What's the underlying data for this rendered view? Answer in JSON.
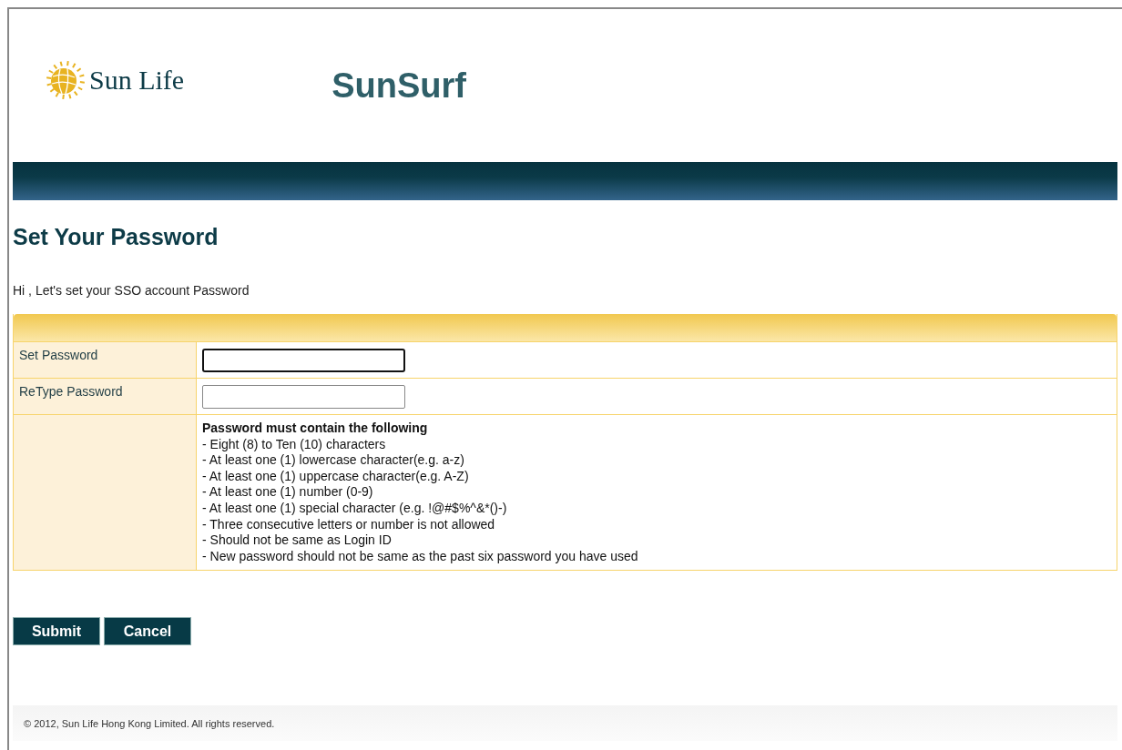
{
  "header": {
    "logo_text": "Sun Life",
    "app_title": "SunSurf"
  },
  "page_title": "Set Your Password",
  "greeting": "Hi  , Let's set your SSO account Password",
  "form": {
    "fields": [
      {
        "label": "Set Password",
        "focused": true
      },
      {
        "label": "ReType Password",
        "focused": false
      }
    ],
    "rules_title": "Password must contain the following",
    "rules": [
      "- Eight (8) to Ten (10) characters",
      "- At least one (1) lowercase character(e.g. a-z)",
      "- At least one (1) uppercase character(e.g. A-Z)",
      "- At least one (1) number (0-9)",
      "- At least one (1) special character (e.g. !@#$%^&*()-)",
      "- Three consecutive letters or number is not allowed",
      "- Should not be same as Login ID",
      "- New password should not be same as the past six password you have used"
    ]
  },
  "buttons": [
    "Submit",
    "Cancel"
  ],
  "footer": "© 2012, Sun Life Hong Kong Limited. All rights reserved."
}
